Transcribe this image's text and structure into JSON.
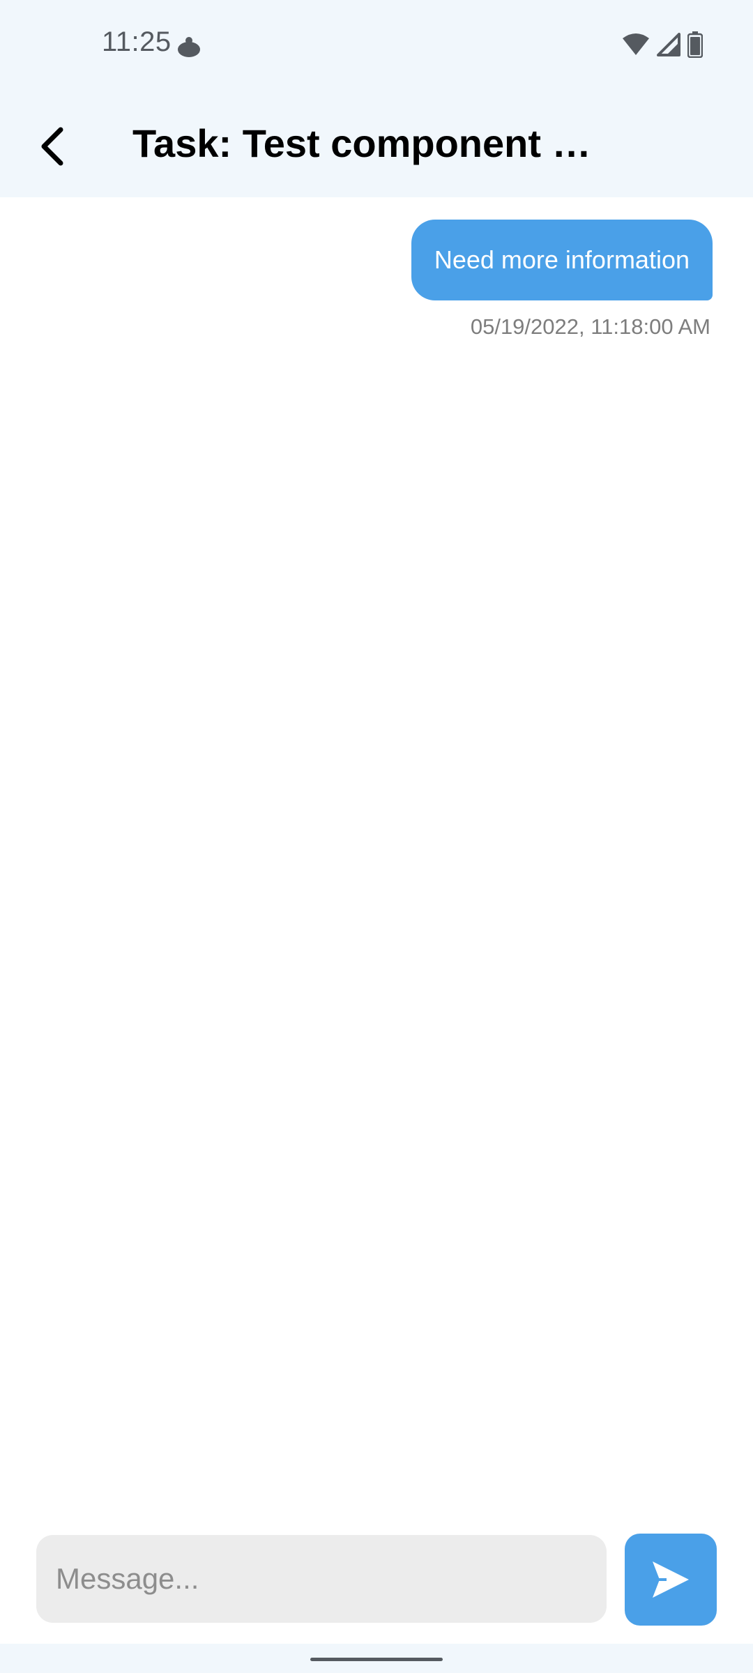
{
  "status_bar": {
    "time": "11:25",
    "app_icon": "notification-app-icon",
    "icons": [
      "wifi-icon",
      "cellular-signal-icon",
      "battery-icon"
    ]
  },
  "header": {
    "back_icon": "chevron-left-icon",
    "title": "Task: Test component …"
  },
  "messages": [
    {
      "text": "Need more information",
      "timestamp": "05/19/2022, 11:18:00 AM",
      "sender": "self"
    }
  ],
  "composer": {
    "placeholder": "Message...",
    "value": "",
    "send_icon": "send-icon"
  },
  "colors": {
    "accent": "#4aa0e8",
    "header_bg": "#f1f7fc",
    "input_bg": "#ececec",
    "timestamp": "#7d7d7d"
  }
}
